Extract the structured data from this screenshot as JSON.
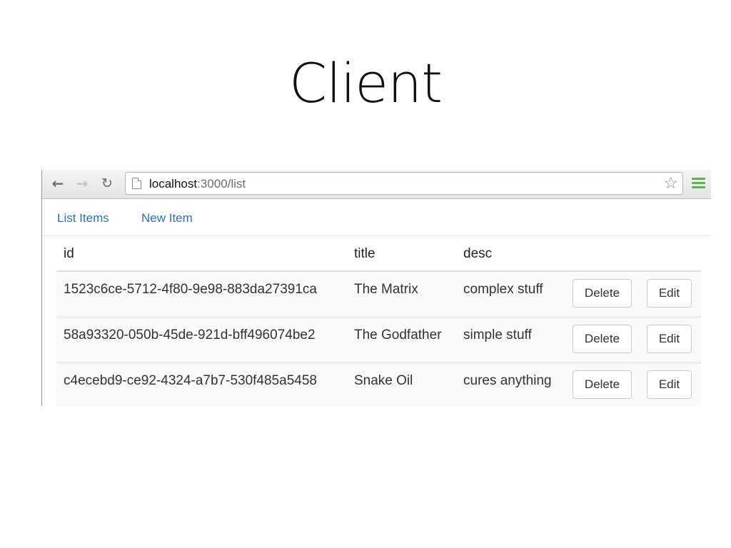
{
  "slide": {
    "title": "Client"
  },
  "browser": {
    "url_host": "localhost",
    "url_path": ":3000/list",
    "icons": {
      "back": "back-arrow-icon",
      "forward": "forward-arrow-icon",
      "reload": "reload-icon",
      "page": "page-icon",
      "bookmark": "star-icon",
      "menu": "menu-icon"
    },
    "menu_color": "#5ab34a"
  },
  "navbar": {
    "links": [
      {
        "label": "List Items"
      },
      {
        "label": "New Item"
      }
    ],
    "link_color": "#2a72b5"
  },
  "table": {
    "headers": [
      "id",
      "title",
      "desc"
    ],
    "rows": [
      {
        "id": "1523c6ce-5712-4f80-9e98-883da27391ca",
        "title": "The Matrix",
        "desc": "complex stuff",
        "delete_label": "Delete",
        "edit_label": "Edit"
      },
      {
        "id": "58a93320-050b-45de-921d-bff496074be2",
        "title": "The Godfather",
        "desc": "simple stuff",
        "delete_label": "Delete",
        "edit_label": "Edit"
      },
      {
        "id": "c4ecebd9-ce92-4324-a7b7-530f485a5458",
        "title": "Snake Oil",
        "desc": "cures anything",
        "delete_label": "Delete",
        "edit_label": "Edit"
      }
    ]
  }
}
